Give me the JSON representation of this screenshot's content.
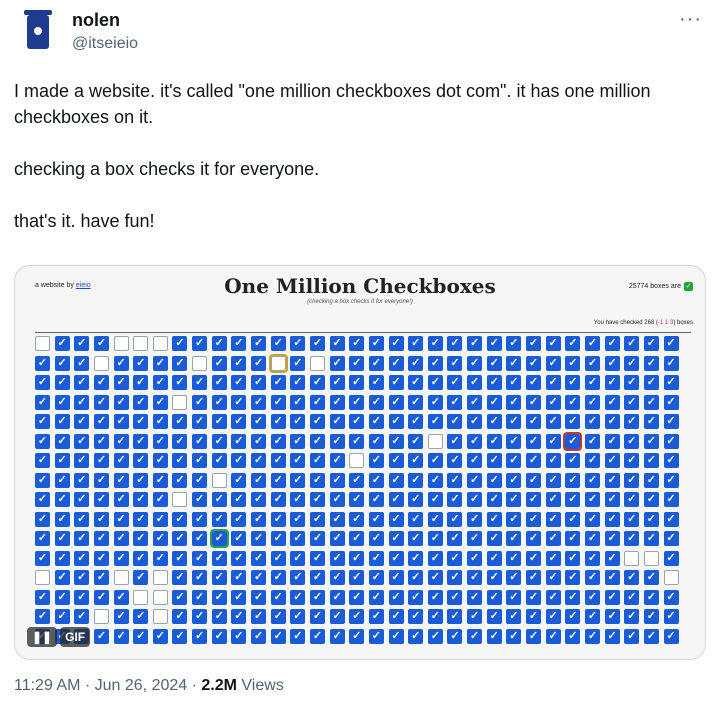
{
  "author": {
    "name": "nolen",
    "handle": "@itseieio",
    "avatar_icon": "trash-bin-avatar"
  },
  "tweet": {
    "paragraphs": [
      "I made a website. it's called \"one million checkboxes dot com\". it has one million checkboxes on it.",
      "checking a box checks it for everyone.",
      "that's it. have fun!"
    ]
  },
  "media": {
    "site": {
      "left_text": "a website by",
      "left_link": "eieio",
      "title": "One Million Checkboxes",
      "subtitle": "(checking a box checks it for everyone!)",
      "count_text": "25774 boxes are",
      "you_checked_prefix": "You have checked 268 (",
      "you_checked_nums": "-1 1 3",
      "you_checked_suffix": ") boxes"
    },
    "grid": {
      "columns": 33,
      "rows": [
        "0111000111111111111111111111111111",
        "111011110111010111111111111111111",
        "111111111111111111111111111111111",
        "111111101111111111111111111111111",
        "111111111111111111111111111111111",
        "111111111111111111110111111111111",
        "111111111111111101111111111111111",
        "111111111011111111111111111111111",
        "111111101111111111111111111111111",
        "111111111111111111111111111111111",
        "111111111111111111111111111111111",
        "111111111111111111111111111111001",
        "011101011111111111111111111111110",
        "111110011111111111111111111111111",
        "111011011111111111111111111111111",
        "111111111111111111111111111111111"
      ],
      "highlights": [
        {
          "row": 1,
          "col": 12,
          "color": "yellow"
        },
        {
          "row": 5,
          "col": 27,
          "color": "red"
        },
        {
          "row": 10,
          "col": 9,
          "color": "green"
        }
      ]
    },
    "gif_label": "GIF",
    "pause_icon": "pause-icon"
  },
  "meta": {
    "time": "11:29 AM",
    "date": "Jun 26, 2024",
    "views_count": "2.2M",
    "views_label": "Views"
  }
}
